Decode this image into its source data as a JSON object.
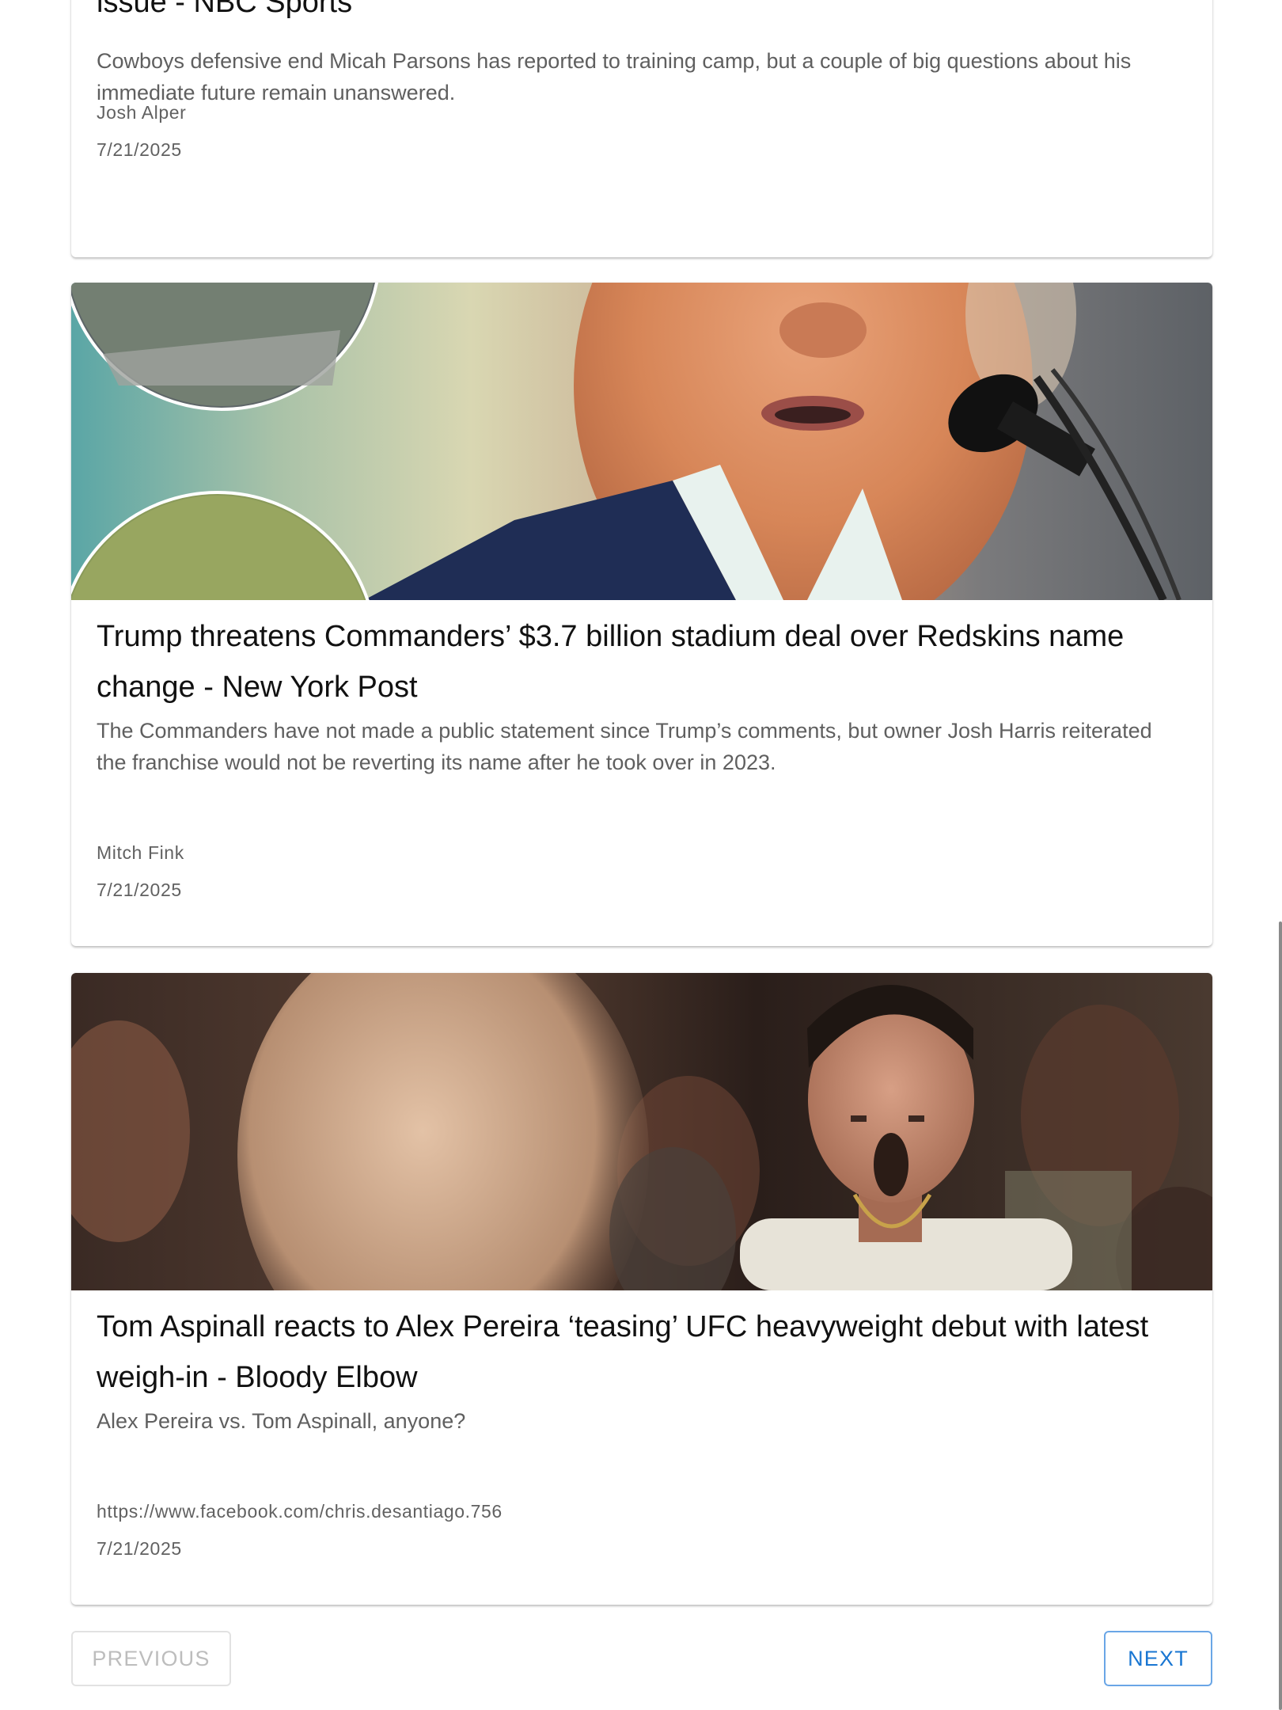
{
  "articles": [
    {
      "title_tail": "issue - NBC Sports",
      "description": "Cowboys defensive end Micah Parsons has reported to training camp, but a couple of big questions about his immediate future remain unanswered.",
      "author": "Josh Alper",
      "date": "7/21/2025"
    },
    {
      "title": "Trump threatens Commanders’ $3.7 billion stadium deal over Redskins name change - New York Post",
      "description": "The Commanders have not made a public statement since Trump’s comments, but owner Josh Harris reiterated the franchise would not be reverting its name after he took over in 2023.",
      "author": "Mitch Fink",
      "date": "7/21/2025",
      "image_alt": "Speaker at a microphone with stadium inset photos"
    },
    {
      "title": "Tom Aspinall reacts to Alex Pereira ‘teasing’ UFC heavyweight debut with latest weigh-in - Bloody Elbow",
      "description": "Alex Pereira vs. Tom Aspinall, anyone?",
      "author": "https://www.facebook.com/chris.desantiago.756",
      "date": "7/21/2025",
      "image_alt": "Fighter in a crowd with blurred foreground face"
    }
  ],
  "pagination": {
    "previous_label": "PREVIOUS",
    "next_label": "NEXT"
  },
  "colors": {
    "accent": "#1976d2",
    "disabled": "#bdbdbd",
    "text_primary": "#111111",
    "text_secondary": "#5f5f5f"
  }
}
